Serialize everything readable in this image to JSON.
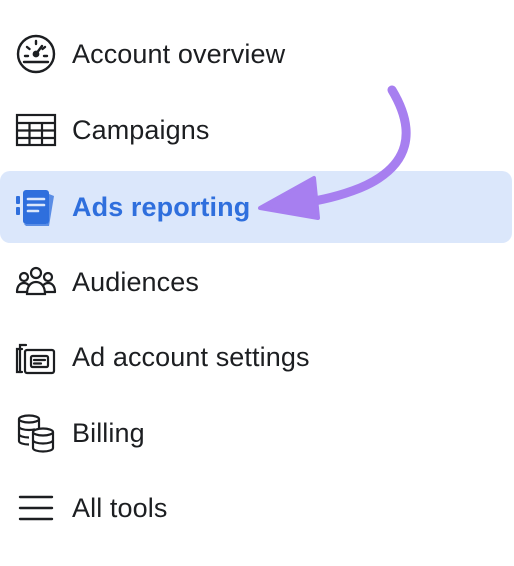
{
  "nav": {
    "items": [
      {
        "label": "Account overview",
        "icon": "dashboard-gauge-icon",
        "active": false
      },
      {
        "label": "Campaigns",
        "icon": "table-grid-icon",
        "active": false
      },
      {
        "label": "Ads reporting",
        "icon": "report-pages-icon",
        "active": true
      },
      {
        "label": "Audiences",
        "icon": "people-group-icon",
        "active": false
      },
      {
        "label": "Ad account settings",
        "icon": "settings-cards-icon",
        "active": false
      },
      {
        "label": "Billing",
        "icon": "coin-stack-icon",
        "active": false
      },
      {
        "label": "All tools",
        "icon": "hamburger-menu-icon",
        "active": false
      }
    ]
  },
  "colors": {
    "active_background": "#dbe7fb",
    "active_text": "#2f6fdd",
    "text": "#1c1e21",
    "icon": "#1c1e21",
    "annotation_arrow": "#a77ff0"
  }
}
